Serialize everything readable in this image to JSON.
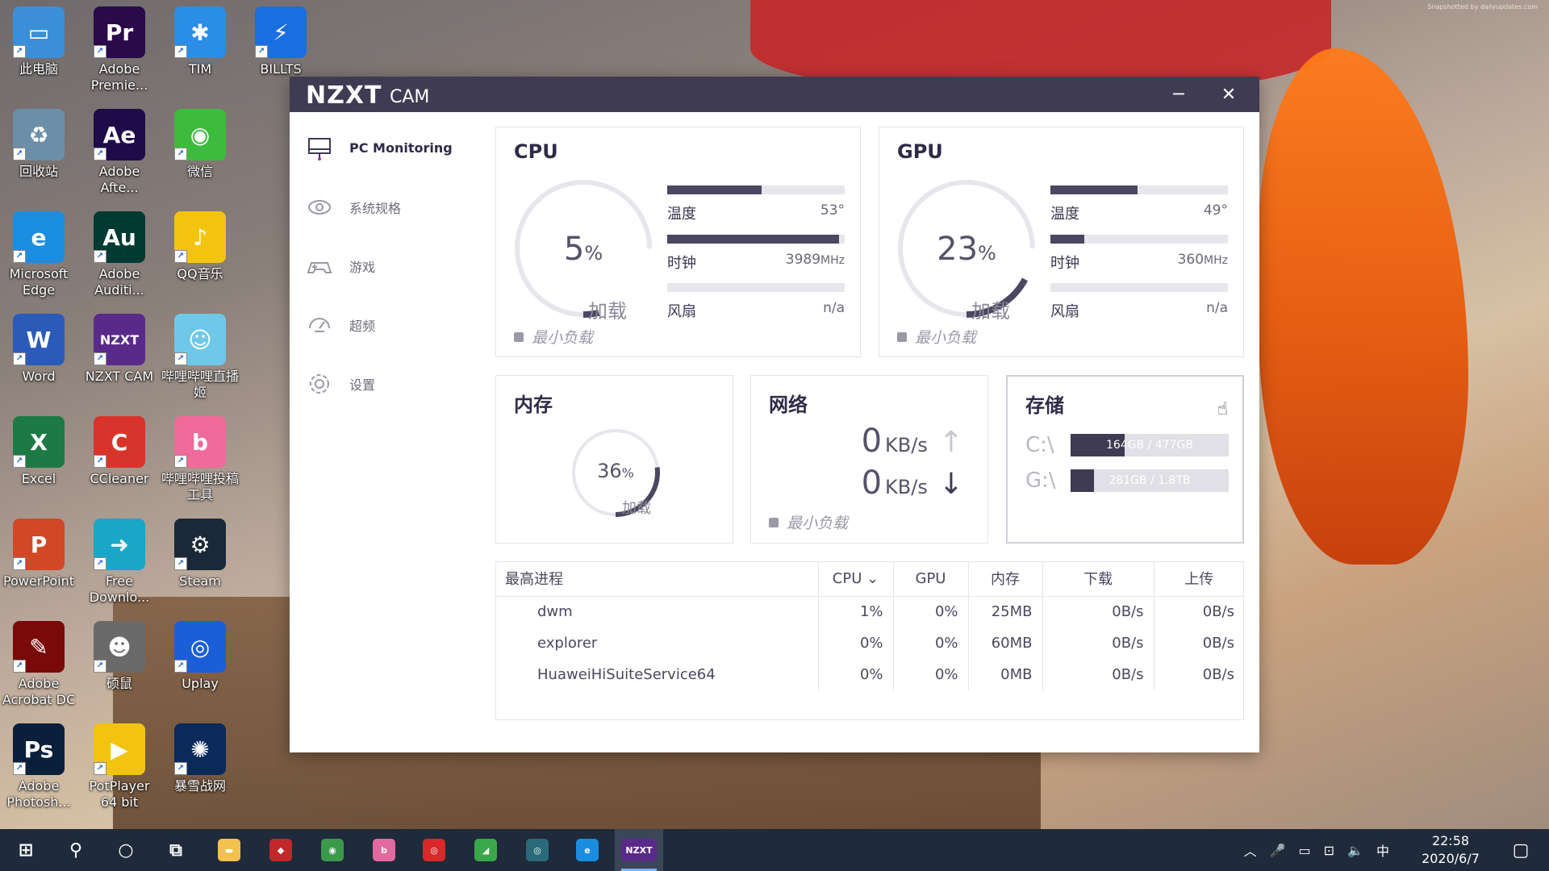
{
  "colors": {
    "titlebar": "#3f3b52",
    "accent": "#4a4760",
    "taskbar": "#1f2a3a"
  },
  "desktop": {
    "watermark": "Snapshotted by dailyupdates.com",
    "icons": [
      {
        "label": "此电脑",
        "icon": "computer-icon",
        "color": "#3b8fd8",
        "glyph": "▭"
      },
      {
        "label": "Adobe Premie...",
        "icon": "premiere-icon",
        "color": "#2a0a4a",
        "glyph": "Pr"
      },
      {
        "label": "TIM",
        "icon": "tim-icon",
        "color": "#2a8de8",
        "glyph": "✱"
      },
      {
        "label": "BILLTS",
        "icon": "billts-icon",
        "color": "#1a6fe0",
        "glyph": "⚡"
      },
      {
        "label": "回收站",
        "icon": "recycle-bin-icon",
        "color": "#6b8fa8",
        "glyph": "♻"
      },
      {
        "label": "Adobe Afte...",
        "icon": "after-effects-icon",
        "color": "#1f0a4a",
        "glyph": "Ae"
      },
      {
        "label": "微信",
        "icon": "wechat-icon",
        "color": "#3dbb3d",
        "glyph": "◉"
      },
      {
        "label": "Microsoft Edge",
        "icon": "edge-icon",
        "color": "#1b8de0",
        "glyph": "e"
      },
      {
        "label": "Adobe Auditi...",
        "icon": "audition-icon",
        "color": "#003a33",
        "glyph": "Au"
      },
      {
        "label": "QQ音乐",
        "icon": "qq-music-icon",
        "color": "#f2c40f",
        "glyph": "♪"
      },
      {
        "label": "Word",
        "icon": "word-icon",
        "color": "#2b5bb8",
        "glyph": "W"
      },
      {
        "label": "NZXT CAM",
        "icon": "nzxt-cam-icon",
        "color": "#5a2a8a",
        "glyph": "NZXT"
      },
      {
        "label": "哔哩哔哩直播姬",
        "icon": "bilibili-live-icon",
        "color": "#6fc8e8",
        "glyph": "☺"
      },
      {
        "label": "Excel",
        "icon": "excel-icon",
        "color": "#1e7a45",
        "glyph": "X"
      },
      {
        "label": "CCleaner",
        "icon": "ccleaner-icon",
        "color": "#d9342b",
        "glyph": "C"
      },
      {
        "label": "哔哩哔哩投稿工具",
        "icon": "bilibili-upload-icon",
        "color": "#f06a9a",
        "glyph": "b"
      },
      {
        "label": "PowerPoint",
        "icon": "powerpoint-icon",
        "color": "#d24726",
        "glyph": "P"
      },
      {
        "label": "Free Downlo...",
        "icon": "free-download-icon",
        "color": "#1aa6c8",
        "glyph": "➜"
      },
      {
        "label": "Steam",
        "icon": "steam-icon",
        "color": "#1b2838",
        "glyph": "⚙"
      },
      {
        "label": "Adobe Acrobat DC",
        "icon": "acrobat-icon",
        "color": "#7a0a0a",
        "glyph": "✎"
      },
      {
        "label": "硕鼠",
        "icon": "shuoshu-icon",
        "color": "#6a6a6a",
        "glyph": "☻"
      },
      {
        "label": "Uplay",
        "icon": "uplay-icon",
        "color": "#1a5fd8",
        "glyph": "◎"
      },
      {
        "label": "Adobe Photosh...",
        "icon": "photoshop-icon",
        "color": "#0a1f3a",
        "glyph": "Ps"
      },
      {
        "label": "PotPlayer 64 bit",
        "icon": "potplayer-icon",
        "color": "#f2c40f",
        "glyph": "▶"
      },
      {
        "label": "暴雪战网",
        "icon": "battlenet-icon",
        "color": "#0a2a5a",
        "glyph": "✺"
      }
    ]
  },
  "window": {
    "brand": "NZXT",
    "brand_sub": "CAM",
    "minimize_label": "─",
    "close_label": "✕"
  },
  "sidebar": {
    "items": [
      {
        "label": "PC Monitoring",
        "icon": "monitor-icon"
      },
      {
        "label": "系统规格",
        "icon": "eye-icon"
      },
      {
        "label": "游戏",
        "icon": "gamepad-icon"
      },
      {
        "label": "超频",
        "icon": "speedometer-icon"
      },
      {
        "label": "设置",
        "icon": "gear-icon"
      }
    ]
  },
  "cpu": {
    "title": "CPU",
    "load_value": "5",
    "load_unit": "%",
    "load_label": "加载",
    "load_fraction": 0.05,
    "min_load_label": "最小负载",
    "temp_label": "温度",
    "temp_value": "53°",
    "temp_fraction": 0.53,
    "clock_label": "时钟",
    "clock_value": "3989",
    "clock_unit": "MHz",
    "clock_fraction": 0.97,
    "fan_label": "风扇",
    "fan_value": "n/a",
    "fan_fraction": 0
  },
  "gpu": {
    "title": "GPU",
    "load_value": "23",
    "load_unit": "%",
    "load_label": "加载",
    "load_fraction": 0.23,
    "min_load_label": "最小负载",
    "temp_label": "温度",
    "temp_value": "49°",
    "temp_fraction": 0.49,
    "clock_label": "时钟",
    "clock_value": "360",
    "clock_unit": "MHz",
    "clock_fraction": 0.19,
    "fan_label": "风扇",
    "fan_value": "n/a",
    "fan_fraction": 0
  },
  "memory": {
    "title": "内存",
    "load_value": "36",
    "load_unit": "%",
    "load_label": "加载",
    "load_fraction": 0.36
  },
  "network": {
    "title": "网络",
    "up_value": "0",
    "up_unit": "KB/s",
    "up_arrow": "↑",
    "down_value": "0",
    "down_unit": "KB/s",
    "down_arrow": "↓",
    "min_load_label": "最小负载"
  },
  "storage": {
    "title": "存储",
    "drives": [
      {
        "letter": "C:\\",
        "text": "164GB / 477GB",
        "fraction": 0.34
      },
      {
        "letter": "G:\\",
        "text": "281GB / 1.8TB",
        "fraction": 0.15
      }
    ]
  },
  "processes": {
    "headers": [
      "最高进程",
      "CPU ⌄",
      "GPU",
      "内存",
      "下载",
      "上传"
    ],
    "rows": [
      {
        "name": "dwm",
        "cpu": "1%",
        "gpu": "0%",
        "mem": "25MB",
        "down": "0B/s",
        "up": "0B/s"
      },
      {
        "name": "explorer",
        "cpu": "0%",
        "gpu": "0%",
        "mem": "60MB",
        "down": "0B/s",
        "up": "0B/s"
      },
      {
        "name": "HuaweiHiSuiteService64",
        "cpu": "0%",
        "gpu": "0%",
        "mem": "0MB",
        "down": "0B/s",
        "up": "0B/s"
      }
    ]
  },
  "taskbar": {
    "items": [
      {
        "icon": "windows-start-icon",
        "color": "",
        "glyph": "⊞"
      },
      {
        "icon": "search-icon",
        "color": "",
        "glyph": "⚲"
      },
      {
        "icon": "cortana-icon",
        "color": "",
        "glyph": "○"
      },
      {
        "icon": "task-view-icon",
        "color": "",
        "glyph": "⧉"
      },
      {
        "icon": "file-explorer-icon",
        "color": "#f2c14e",
        "glyph": "▬"
      },
      {
        "icon": "app-red-icon",
        "color": "#c0282a",
        "glyph": "◆"
      },
      {
        "icon": "chrome-icon",
        "color": "#3a9a4a",
        "glyph": "◉"
      },
      {
        "icon": "bilibili-icon",
        "color": "#e06aa0",
        "glyph": "b"
      },
      {
        "icon": "netease-music-icon",
        "color": "#d8282a",
        "glyph": "◎"
      },
      {
        "icon": "app-green-icon",
        "color": "#3aa84a",
        "glyph": "◢"
      },
      {
        "icon": "app-circle-icon",
        "color": "#2a6a7a",
        "glyph": "◎"
      },
      {
        "icon": "edge-icon",
        "color": "#1b8de0",
        "glyph": "e"
      },
      {
        "icon": "nzxt-cam-icon",
        "color": "#5a2a8a",
        "glyph": "NZXT"
      }
    ],
    "tray": [
      "︿",
      "🎤",
      "▭",
      "⊡",
      "🔈",
      "中"
    ],
    "time": "22:58",
    "date": "2020/6/7",
    "notification_icon": "▢"
  }
}
